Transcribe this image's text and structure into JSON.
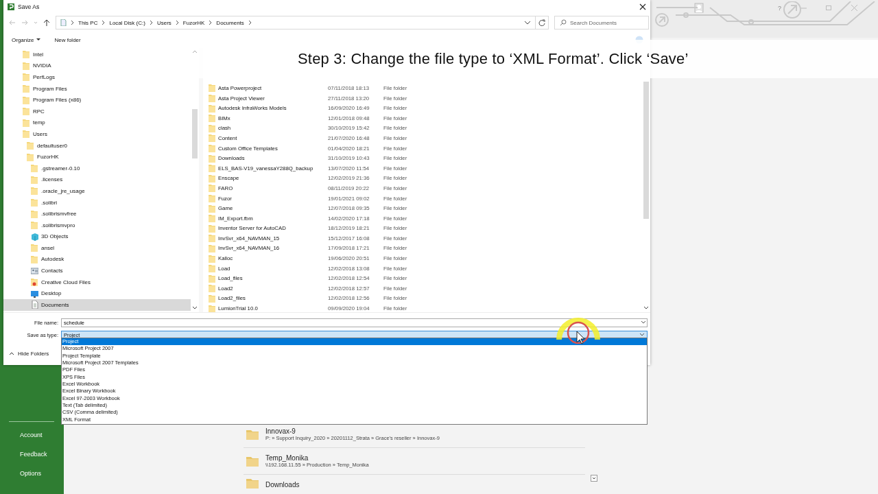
{
  "app": {
    "help": "?",
    "sidebar_items": [
      "Account",
      "Feedback",
      "Options"
    ],
    "recent": [
      {
        "name": "Innovax-9",
        "path": "P: » Support Inquiry_2020 » 20201112_Strata » Grace's reseller » Innovax-9"
      },
      {
        "name": "Temp_Monika",
        "path": "\\\\192.168.11.55 » Production » Temp_Monika"
      },
      {
        "name": "Downloads"
      }
    ]
  },
  "caption": "Step 3: Change the file type to ‘XML Format’. Click ‘Save’",
  "dialog": {
    "title": "Save As",
    "breadcrumb": [
      "This PC",
      "Local Disk (C:)",
      "Users",
      "FuzorHK",
      "Documents"
    ],
    "search": {
      "placeholder": "Search Documents"
    },
    "toolbar": [
      {
        "label": "Organize",
        "kind": "menu"
      },
      {
        "label": "New folder",
        "kind": "button"
      }
    ],
    "tree": [
      {
        "label": "Intel",
        "kind": "folder",
        "selected": false
      },
      {
        "label": "NVIDIA",
        "kind": "folder",
        "selected": false
      },
      {
        "label": "PerfLogs",
        "kind": "folder",
        "selected": false
      },
      {
        "label": "Program Files",
        "kind": "folder",
        "selected": false
      },
      {
        "label": "Program Files (x86)",
        "kind": "folder",
        "selected": false
      },
      {
        "label": "RPC",
        "kind": "folder",
        "selected": false
      },
      {
        "label": "temp",
        "kind": "folder",
        "selected": false
      },
      {
        "label": "Users",
        "kind": "folder",
        "selected": false,
        "children": [
          {
            "label": "defaultuser0",
            "kind": "folder",
            "selected": false
          },
          {
            "label": "FuzorHK",
            "kind": "folder",
            "selected": false,
            "children": [
              {
                "label": ".gstreamer-0.10",
                "kind": "folder",
                "selected": false
              },
              {
                "label": ".licenses",
                "kind": "folder",
                "selected": false
              },
              {
                "label": ".oracle_jre_usage",
                "kind": "folder",
                "selected": false
              },
              {
                "label": ".solibri",
                "kind": "folder",
                "selected": false
              },
              {
                "label": ".solibrismvfree",
                "kind": "folder",
                "selected": false
              },
              {
                "label": ".solibrismvpro",
                "kind": "folder",
                "selected": false
              },
              {
                "label": "3D Objects",
                "kind": "objects",
                "selected": false
              },
              {
                "label": "ansel",
                "kind": "folder",
                "selected": false
              },
              {
                "label": "Autodesk",
                "kind": "folder",
                "selected": false
              },
              {
                "label": "Contacts",
                "kind": "contacts",
                "selected": false
              },
              {
                "label": "Creative Cloud Files",
                "kind": "cloud",
                "selected": false
              },
              {
                "label": "Desktop",
                "kind": "desktop",
                "selected": false
              },
              {
                "label": "Documents",
                "kind": "document",
                "selected": true
              }
            ]
          }
        ]
      }
    ],
    "files": [
      {
        "name": "Asta Powerproject",
        "date": "07/11/2018 18:13",
        "type": "File folder"
      },
      {
        "name": "Asta Project Viewer",
        "date": "27/11/2018 13:20",
        "type": "File folder"
      },
      {
        "name": "Autodesk InfraWorks Models",
        "date": "16/09/2020 16:49",
        "type": "File folder"
      },
      {
        "name": "BIMx",
        "date": "12/01/2018 09:48",
        "type": "File folder"
      },
      {
        "name": "clash",
        "date": "30/10/2019 15:42",
        "type": "File folder"
      },
      {
        "name": "Content",
        "date": "21/07/2020 16:48",
        "type": "File folder"
      },
      {
        "name": "Custom Office Templates",
        "date": "01/04/2020 18:21",
        "type": "File folder"
      },
      {
        "name": "Downloads",
        "date": "31/10/2019 10:43",
        "type": "File folder"
      },
      {
        "name": "ELS_BAS-V19_vanessaY288Q_backup",
        "date": "13/07/2020 11:54",
        "type": "File folder"
      },
      {
        "name": "Enscape",
        "date": "12/02/2019 21:36",
        "type": "File folder"
      },
      {
        "name": "FARO",
        "date": "08/11/2019 20:22",
        "type": "File folder"
      },
      {
        "name": "Fuzor",
        "date": "19/01/2021 09:02",
        "type": "File folder"
      },
      {
        "name": "Game",
        "date": "12/07/2018 09:35",
        "type": "File folder"
      },
      {
        "name": "IM_Export.fbm",
        "date": "14/02/2020 17:18",
        "type": "File folder"
      },
      {
        "name": "Inventor Server for AutoCAD",
        "date": "18/12/2019 18:21",
        "type": "File folder"
      },
      {
        "name": "InvSvr_x64_NAVMAN_15",
        "date": "15/12/2017 16:08",
        "type": "File folder"
      },
      {
        "name": "InvSvr_x64_NAVMAN_16",
        "date": "17/09/2018 17:21",
        "type": "File folder"
      },
      {
        "name": "Kalloc",
        "date": "19/06/2020 20:51",
        "type": "File folder"
      },
      {
        "name": "Load",
        "date": "12/02/2018 13:08",
        "type": "File folder"
      },
      {
        "name": "Load_files",
        "date": "12/02/2018 12:54",
        "type": "File folder"
      },
      {
        "name": "Load2",
        "date": "12/02/2018 12:57",
        "type": "File folder"
      },
      {
        "name": "Load2_files",
        "date": "12/02/2018 12:56",
        "type": "File folder"
      },
      {
        "name": "LumionTrial 10.0",
        "date": "09/09/2020 19:04",
        "type": "File folder"
      }
    ],
    "file_name": {
      "label": "File name:",
      "value": "schedule"
    },
    "save_type": {
      "label": "Save as type:",
      "value": "Project",
      "expanded": true,
      "options": [
        {
          "label": "Project",
          "selected": true
        },
        {
          "label": "Microsoft Project 2007",
          "selected": false
        },
        {
          "label": "Project Template",
          "selected": false
        },
        {
          "label": "Microsoft Project 2007 Templates",
          "selected": false
        },
        {
          "label": "PDF Files",
          "selected": false
        },
        {
          "label": "XPS Files",
          "selected": false
        },
        {
          "label": "Excel Workbook",
          "selected": false
        },
        {
          "label": "Excel Binary Workbook",
          "selected": false
        },
        {
          "label": "Excel 97-2003 Workbook",
          "selected": false
        },
        {
          "label": "Text (Tab delimited)",
          "selected": false
        },
        {
          "label": "CSV (Comma delimited)",
          "selected": false
        },
        {
          "label": "XML Format",
          "selected": false
        }
      ]
    },
    "hide_folders": "Hide Folders"
  }
}
